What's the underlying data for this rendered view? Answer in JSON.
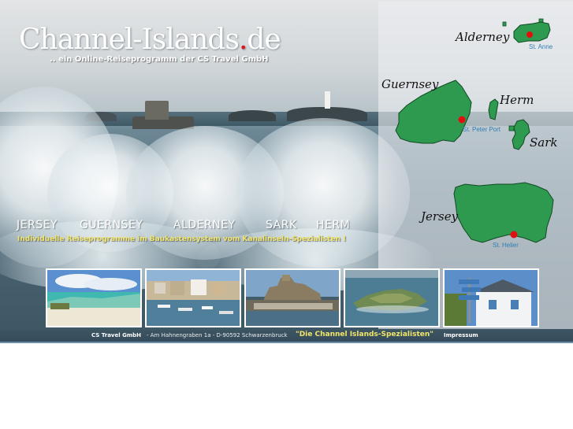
{
  "logo": {
    "text": "Channel-Islands",
    "dot": ".",
    "suffix": "de"
  },
  "tagline": ".. ein Online-Reiseprogramm der CS Travel GmbH",
  "nav": {
    "items": [
      "JERSEY",
      "GUERNSEY",
      "ALDERNEY",
      "SARK",
      "HERM"
    ]
  },
  "subtitle": "Individuelle Reiseprogramme im Baukastensystem vom Kanalinseln-Spezialisten !",
  "map": {
    "islands": {
      "alderney": "Alderney",
      "guernsey": "Guernsey",
      "herm": "Herm",
      "sark": "Sark",
      "jersey": "Jersey"
    },
    "towns": {
      "alderney": "St. Anne",
      "guernsey": "St. Peter Port",
      "jersey": "St. Helier"
    },
    "colors": {
      "land": "#2e9a4f",
      "outline": "#0f4a22",
      "town_marker": "#e01010",
      "town_label": "#2f7fb5"
    }
  },
  "photos": [
    {
      "name": "beach"
    },
    {
      "name": "harbour"
    },
    {
      "name": "castle"
    },
    {
      "name": "island-aerial"
    },
    {
      "name": "signpost-cottage"
    }
  ],
  "footer": {
    "company": "CS Travel GmbH",
    "address": "- Am Hahnengraben 1a - D-90592 Schwarzenbruck",
    "slogan": "\"Die Channel Islands-Spezialisten\"",
    "impressum": "Impressum"
  }
}
